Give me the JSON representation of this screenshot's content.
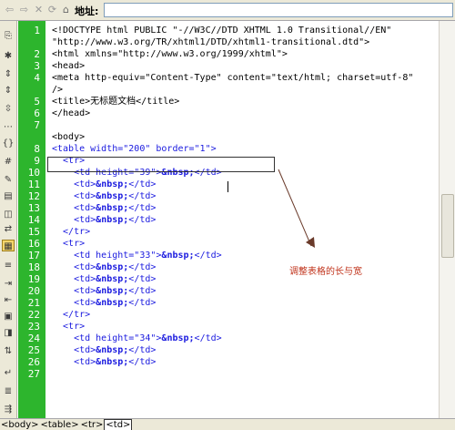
{
  "address_bar": {
    "label": "地址:",
    "value": ""
  },
  "nav": {
    "back": "⇦",
    "forward": "⇨",
    "stop": "✕",
    "refresh": "⟳",
    "home": "⌂"
  },
  "line_numbers": [
    "1",
    "2",
    "3",
    "4",
    "5",
    "6",
    "7",
    "8",
    "9",
    "10",
    "11",
    "12",
    "13",
    "14",
    "15",
    "16",
    "17",
    "18",
    "19",
    "20",
    "21",
    "22",
    "23",
    "24",
    "25",
    "26",
    "27"
  ],
  "code_lines": [
    "<!DOCTYPE html PUBLIC \"-//W3C//DTD XHTML 1.0 Transitional//EN\"",
    "\"http://www.w3.org/TR/xhtml1/DTD/xhtml1-transitional.dtd\">",
    "<html xmlns=\"http://www.w3.org/1999/xhtml\">",
    "<head>",
    "<meta http-equiv=\"Content-Type\" content=\"text/html; charset=utf-8\"",
    "/>",
    "<title>无标题文档</title>",
    "</head>",
    "",
    "<body>",
    "<table width=\"200\" border=\"1\">",
    "  <tr>",
    "    <td height=\"39\">&nbsp;</td>",
    "    <td>&nbsp;</td>",
    "    <td>&nbsp;</td>",
    "    <td>&nbsp;</td>",
    "    <td>&nbsp;</td>",
    "  </tr>",
    "  <tr>",
    "    <td height=\"33\">&nbsp;</td>",
    "    <td>&nbsp;</td>",
    "    <td>&nbsp;</td>",
    "    <td>&nbsp;</td>",
    "    <td>&nbsp;</td>",
    "  </tr>",
    "  <tr>",
    "    <td height=\"34\">&nbsp;</td>",
    "    <td>&nbsp;</td>",
    "    <td>&nbsp;</td>"
  ],
  "annotation": "调整表格的长与宽",
  "status_bar": {
    "crumbs": [
      "<body>",
      "<table>",
      "<tr>",
      "<td>"
    ]
  },
  "colors": {
    "gutter": "#2db52d",
    "tag": "#1a1adf",
    "annotation": "#c0321a"
  }
}
